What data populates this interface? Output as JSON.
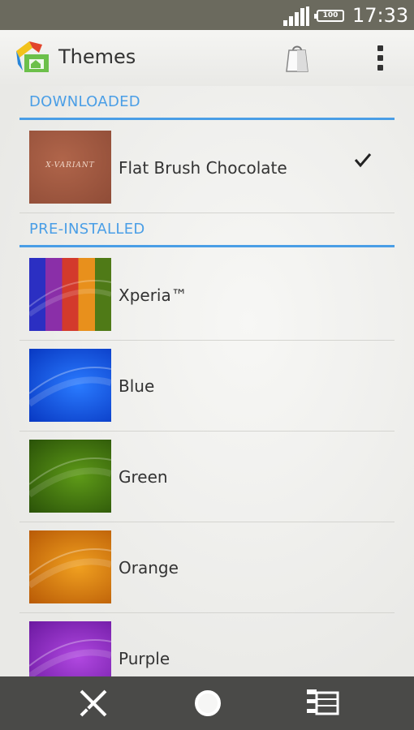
{
  "status_bar": {
    "battery": "100",
    "time": "17:33"
  },
  "action_bar": {
    "title": "Themes",
    "icons": [
      "app-icon",
      "store-bag-icon",
      "overflow-menu-icon"
    ]
  },
  "sections": {
    "downloaded": {
      "header": "DOWNLOADED",
      "items": [
        {
          "label": "Flat Brush Chocolate",
          "thumb_text": "X-VARIANT",
          "selected": true
        }
      ]
    },
    "preinstalled": {
      "header": "PRE-INSTALLED",
      "items": [
        {
          "label": "Xperia™"
        },
        {
          "label": "Blue"
        },
        {
          "label": "Green"
        },
        {
          "label": "Orange"
        },
        {
          "label": "Purple"
        }
      ]
    }
  },
  "colors": {
    "accent": "#4a9ee6",
    "status_bar": "#6b6a5e",
    "nav_bar": "#4a4a48"
  },
  "nav_bar": {
    "icons": [
      "back-icon",
      "home-icon",
      "recent-apps-icon"
    ]
  }
}
